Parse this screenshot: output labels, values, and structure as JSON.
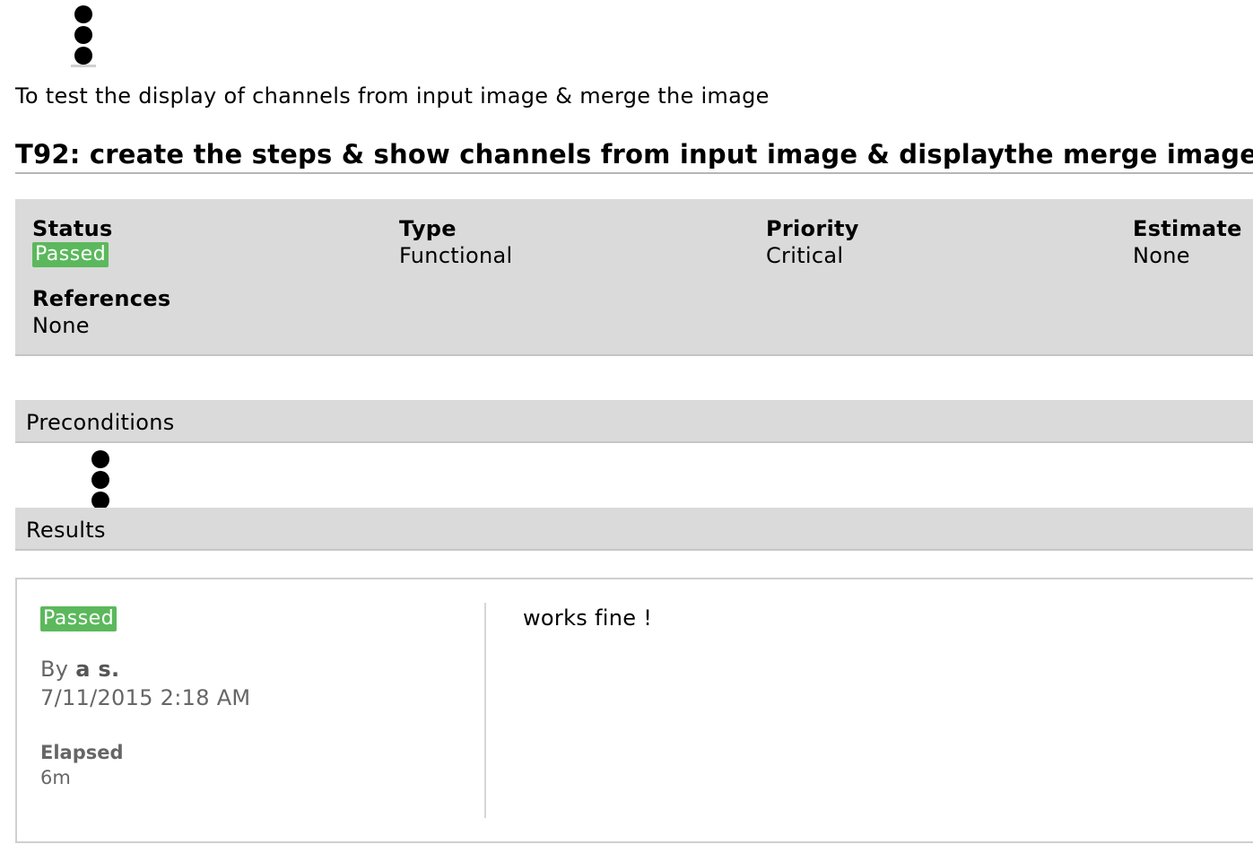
{
  "description": "To test the display of channels from input image & merge the image",
  "title": "T92: create the steps & show channels from input image & displaythe merge image",
  "fields": {
    "status_label": "Status",
    "status_value": "Passed",
    "type_label": "Type",
    "type_value": "Functional",
    "priority_label": "Priority",
    "priority_value": "Critical",
    "estimate_label": "Estimate",
    "estimate_value": "None",
    "references_label": "References",
    "references_value": "None"
  },
  "sections": {
    "preconditions": "Preconditions",
    "results": "Results"
  },
  "result": {
    "status": "Passed",
    "by_prefix": "By",
    "by_user": "a s.",
    "date": "7/11/2015 2:18 AM",
    "elapsed_label": "Elapsed",
    "elapsed_value": "6m",
    "comment": "works fine !"
  },
  "colors": {
    "passed_badge": "#5cb85c",
    "panel_bg": "#dadada"
  },
  "icons": [
    "loading-dots-icon",
    "loading-dots-icon"
  ]
}
